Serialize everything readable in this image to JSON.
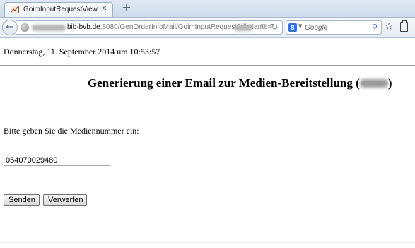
{
  "browser": {
    "tab": {
      "title": "GoimInputRequestView"
    },
    "new_tab_symbol": "+",
    "url": {
      "host": "bib-bvb.de",
      "path": ":8080/GenOrderInfoMail/GoimInputRequest?dbName="
    },
    "search": {
      "engine": "8",
      "placeholder": "Google"
    }
  },
  "page": {
    "datetime": "Donnerstag, 11. September 2014 um 10:53:57",
    "heading_prefix": "Generierung einer Email zur Medien-Bereitstellung (",
    "heading_suffix": ")",
    "prompt": "Bitte geben Sie die Mediennummer ein:",
    "media_number": "054070029480",
    "buttons": {
      "send": "Senden",
      "discard": "Verwerfen"
    }
  }
}
